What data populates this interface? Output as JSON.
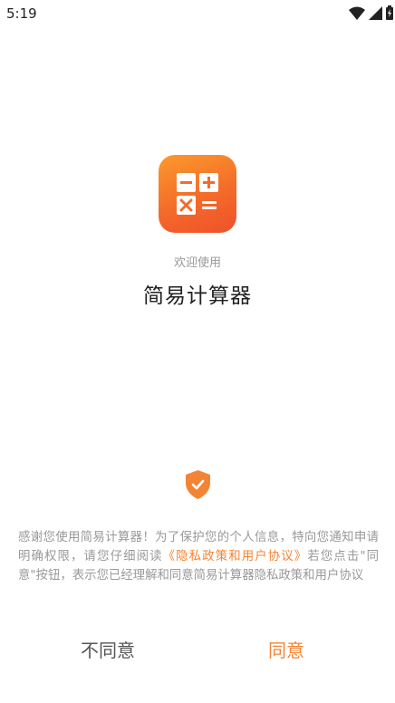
{
  "status_bar": {
    "time": "5:19",
    "icons": [
      "wifi-icon",
      "cellular-signal-icon",
      "battery-icon"
    ]
  },
  "splash": {
    "app_icon": "calculator-icon",
    "welcome_text": "欢迎使用",
    "app_name": "简易计算器"
  },
  "privacy": {
    "icon": "shield-check-icon",
    "text_before": "感谢您使用简易计算器！为了保护您的个人信息，特向您通知申请明确权限，请您仔细阅读",
    "link_text": "《隐私政策和用户协议》",
    "text_after": "若您点击\"同意\"按钮，表示您已经理解和同意简易计算器隐私政策和用户协议"
  },
  "buttons": {
    "disagree_label": "不同意",
    "agree_label": "同意"
  },
  "colors": {
    "accent": "#f38434",
    "icon_gradient_top": "#fb9a2c",
    "icon_gradient_bottom": "#f0502a",
    "muted_text": "#999999"
  }
}
